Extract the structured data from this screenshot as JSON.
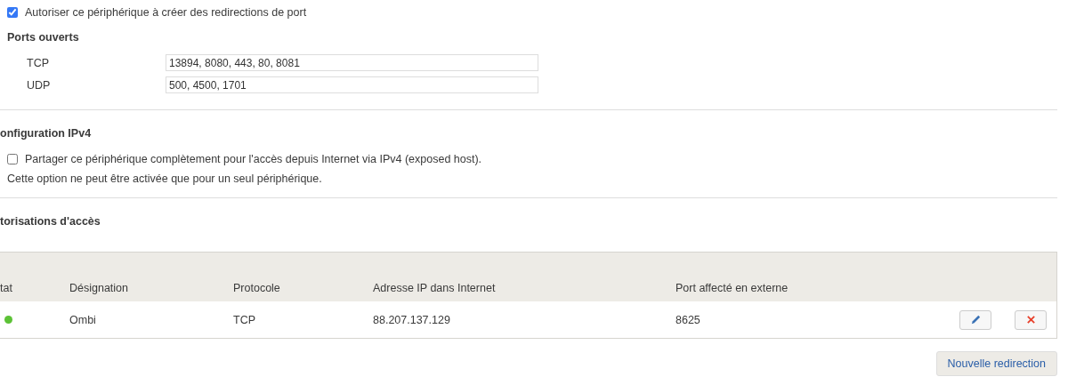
{
  "port_forwarding": {
    "label": "Autoriser ce périphérique à créer des redirections de port",
    "checked": true
  },
  "open_ports": {
    "title": "Ports ouverts",
    "fields": [
      {
        "label": "TCP",
        "value": "13894, 8080, 443, 80, 8081"
      },
      {
        "label": "UDP",
        "value": "500, 4500, 1701"
      }
    ]
  },
  "ipv4": {
    "title": "onfiguration IPv4",
    "exposed_host": {
      "label": "Partager ce périphérique complètement pour l'accès depuis Internet via IPv4 (exposed host).",
      "checked": false
    },
    "note": "Cette option ne peut être activée que pour un seul périphérique."
  },
  "access": {
    "title": "torisations d'accès",
    "table": {
      "columns": [
        "tat",
        "Désignation",
        "Protocole",
        "Adresse IP dans Internet",
        "Port affecté en externe"
      ],
      "rows": [
        {
          "color": "#5cc236",
          "cells": [
            "",
            "Ombi",
            "TCP",
            "88.207.137.129",
            "8625"
          ]
        }
      ]
    },
    "new_button": "Nouvelle redirection"
  }
}
